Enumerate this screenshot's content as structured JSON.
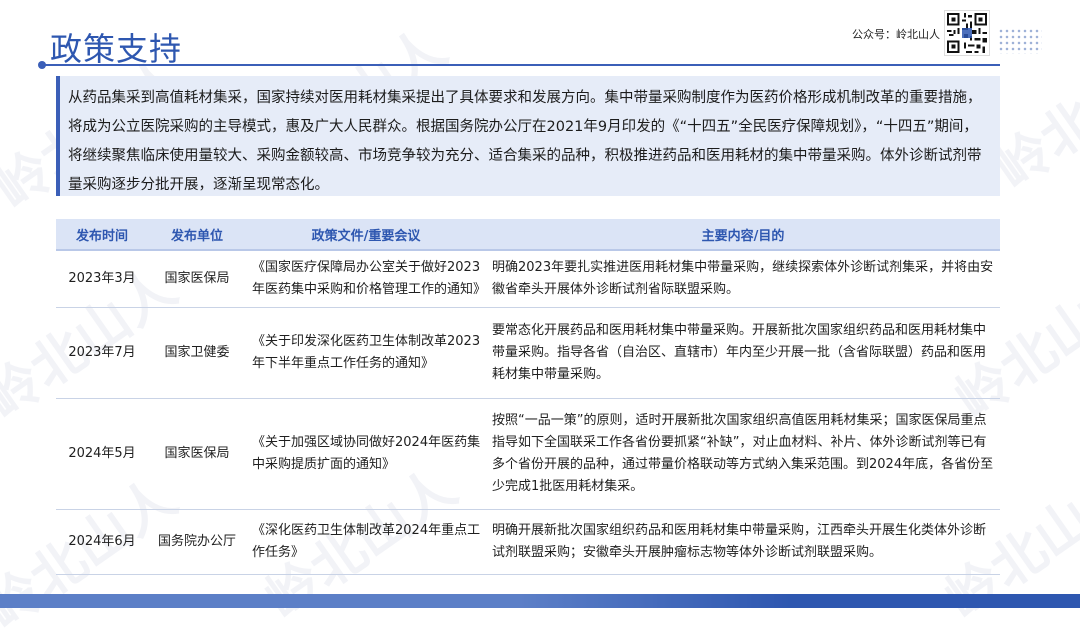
{
  "header": {
    "title": "政策支持",
    "account_label": "公众号：岭北山人"
  },
  "watermark_text": "岭北山人",
  "intro": {
    "text": "从药品集采到高值耗材集采，国家持续对医用耗材集采提出了具体要求和发展方向。集中带量采购制度作为医药价格形成机制改革的重要措施，将成为公立医院采购的主导模式，惠及广大人民群众。根据国务院办公厅在2021年9月印发的《“十四五”全民医疗保障规划》，“十四五”期间，将继续聚焦临床使用量较大、采购金额较高、市场竞争较为充分、适合集采的品种，积极推进药品和医用耗材的集中带量采购。体外诊断试剂带量采购逐步分批开展，逐渐呈现常态化。"
  },
  "table": {
    "headers": [
      "发布时间",
      "发布单位",
      "政策文件/重要会议",
      "主要内容/目的"
    ],
    "rows": [
      {
        "date": "2023年3月",
        "unit": "国家医保局",
        "document": "《国家医疗保障局办公室关于做好2023年医药集中采购和价格管理工作的通知》",
        "content": "明确2023年要扎实推进医用耗材集中带量采购，继续探索体外诊断试剂集采，并将由安徽省牵头开展体外诊断试剂省际联盟采购。"
      },
      {
        "date": "2023年7月",
        "unit": "国家卫健委",
        "document": "《关于印发深化医药卫生体制改革2023年下半年重点工作任务的通知》",
        "content": "要常态化开展药品和医用耗材集中带量采购。开展新批次国家组织药品和医用耗材集中带量采购。指导各省（自治区、直辖市）年内至少开展一批（含省际联盟）药品和医用耗材集中带量采购。"
      },
      {
        "date": "2024年5月",
        "unit": "国家医保局",
        "document": "《关于加强区域协同做好2024年医药集中采购提质扩面的通知》",
        "content": "按照“一品一策”的原则，适时开展新批次国家组织高值医用耗材集采；国家医保局重点指导如下全国联采工作各省份要抓紧“补缺”，对止血材料、补片、体外诊断试剂等已有多个省份开展的品种，通过带量价格联动等方式纳入集采范围。到2024年底，各省份至少完成1批医用耗材集采。"
      },
      {
        "date": "2024年6月",
        "unit": "国务院办公厅",
        "document": "《深化医药卫生体制改革2024年重点工作任务》",
        "content": "明确开展新批次国家组织药品和医用耗材集中带量采购，江西牵头开展生化类体外诊断试剂联盟采购；安徽牵头开展肿瘤标志物等体外诊断试剂联盟采购。"
      }
    ]
  },
  "colors": {
    "accent": "#2e57b0",
    "intro_bg": "#e6ecf8",
    "header_bg": "#dbe4f6"
  }
}
